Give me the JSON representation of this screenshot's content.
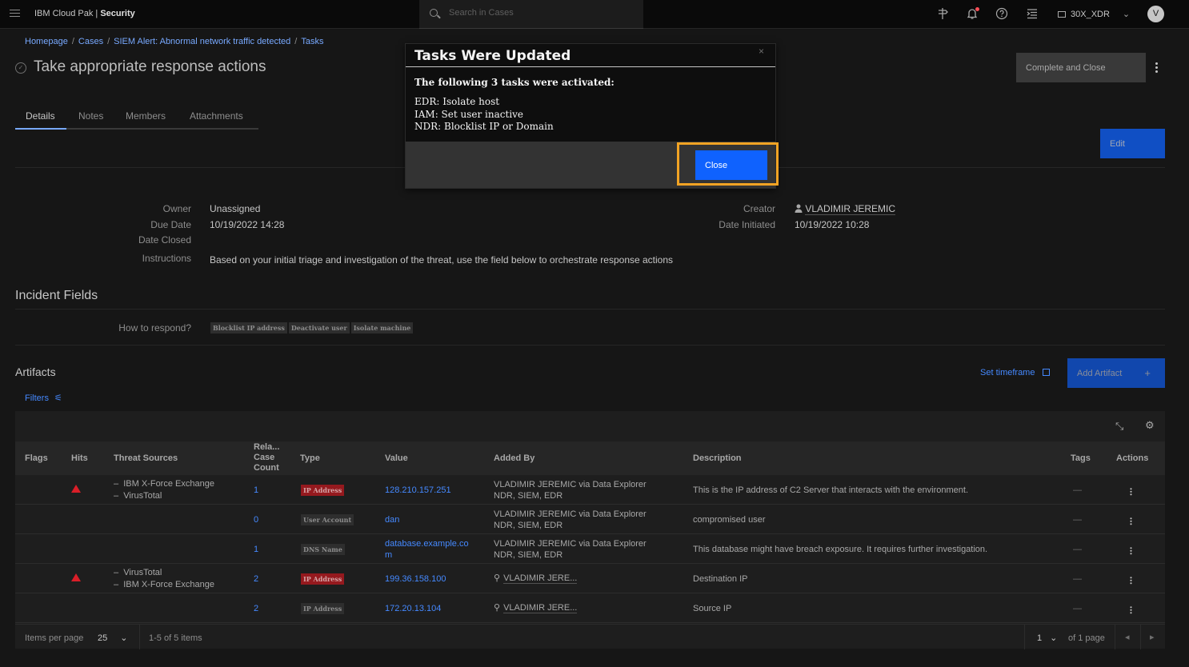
{
  "topbar": {
    "brand_prefix": "IBM Cloud Pak | ",
    "brand_bold": "Security",
    "search_placeholder": "Search in Cases",
    "tenant": "30X_XDR",
    "avatar_initial": "V"
  },
  "breadcrumb": [
    "Homepage",
    "Cases",
    "SIEM Alert: Abnormal network traffic detected",
    "Tasks"
  ],
  "page": {
    "title": "Take appropriate response actions",
    "complete_button": "Complete and Close",
    "edit_button": "Edit"
  },
  "tabs": [
    "Details",
    "Notes",
    "Members",
    "Attachments"
  ],
  "details": {
    "owner_label": "Owner",
    "owner": "Unassigned",
    "due_label": "Due Date",
    "due": "10/19/2022 14:28",
    "closed_label": "Date Closed",
    "closed": "",
    "instructions_label": "Instructions",
    "instructions": "Based on your initial triage and investigation of the threat, use the field below to orchestrate response actions",
    "creator_label": "Creator",
    "creator": "VLADIMIR JEREMIC",
    "initiated_label": "Date Initiated",
    "initiated": "10/19/2022 10:28"
  },
  "incident_fields": {
    "title": "Incident Fields",
    "respond_label": "How to respond?",
    "respond_tags": [
      "Blocklist IP address",
      "Deactivate user",
      "Isolate machine"
    ]
  },
  "artifacts": {
    "title": "Artifacts",
    "filters": "Filters",
    "set_timeframe": "Set timeframe",
    "add_button": "Add Artifact",
    "columns": [
      "Flags",
      "Hits",
      "Threat Sources",
      "Rela... Case Count",
      "Type",
      "Value",
      "Added By",
      "Description",
      "Tags",
      "Actions"
    ],
    "rows": [
      {
        "hit": true,
        "sources": [
          "IBM X-Force Exchange",
          "VirusTotal"
        ],
        "count": "1",
        "type": "IP Address",
        "type_color": "red",
        "value": [
          "128.210.157.251"
        ],
        "added_by": [
          "VLADIMIR JEREMIC via Data Explorer",
          "NDR, SIEM, EDR"
        ],
        "added_user_icon": false,
        "description": "This is the IP address of C2 Server that interacts with the environment.",
        "tags": "—"
      },
      {
        "hit": false,
        "sources": [],
        "count": "0",
        "type": "User Account",
        "type_color": "gray",
        "value": [
          "dan"
        ],
        "added_by": [
          "VLADIMIR JEREMIC via Data Explorer",
          "NDR, SIEM, EDR"
        ],
        "added_user_icon": false,
        "description": "compromised user",
        "tags": "—"
      },
      {
        "hit": false,
        "sources": [],
        "count": "1",
        "type": "DNS Name",
        "type_color": "gray",
        "value": [
          "database.example.co",
          "m"
        ],
        "added_by": [
          "VLADIMIR JEREMIC via Data Explorer",
          "NDR, SIEM, EDR"
        ],
        "added_user_icon": false,
        "description": "This database might have breach exposure. It requires further investigation.",
        "tags": "—"
      },
      {
        "hit": true,
        "sources": [
          "VirusTotal",
          "IBM X-Force Exchange"
        ],
        "count": "2",
        "type": "IP Address",
        "type_color": "red",
        "value": [
          "199.36.158.100"
        ],
        "added_by": [
          "VLADIMIR JERE..."
        ],
        "added_user_icon": true,
        "description": "Destination IP",
        "tags": "—"
      },
      {
        "hit": false,
        "sources": [],
        "count": "2",
        "type": "IP Address",
        "type_color": "gray",
        "value": [
          "172.20.13.104"
        ],
        "added_by": [
          "VLADIMIR JERE..."
        ],
        "added_user_icon": true,
        "description": "Source IP",
        "tags": "—"
      }
    ],
    "pager": {
      "items_per_page_label": "Items per page",
      "items_per_page": "25",
      "range": "1-5 of 5 items",
      "page": "1",
      "of_pages": "of 1 page"
    }
  },
  "modal": {
    "title": "Tasks Were Updated",
    "subtitle": "The following 3 tasks were activated:",
    "lines": [
      "EDR: Isolate host",
      "IAM: Set user inactive",
      "NDR: Blocklist IP or Domain"
    ],
    "close_button": "Close",
    "close_x": "×"
  },
  "colors": {
    "accent": "#0f62fe",
    "link": "#4589ff",
    "focus": "#f1a324",
    "danger": "#da1e28"
  }
}
